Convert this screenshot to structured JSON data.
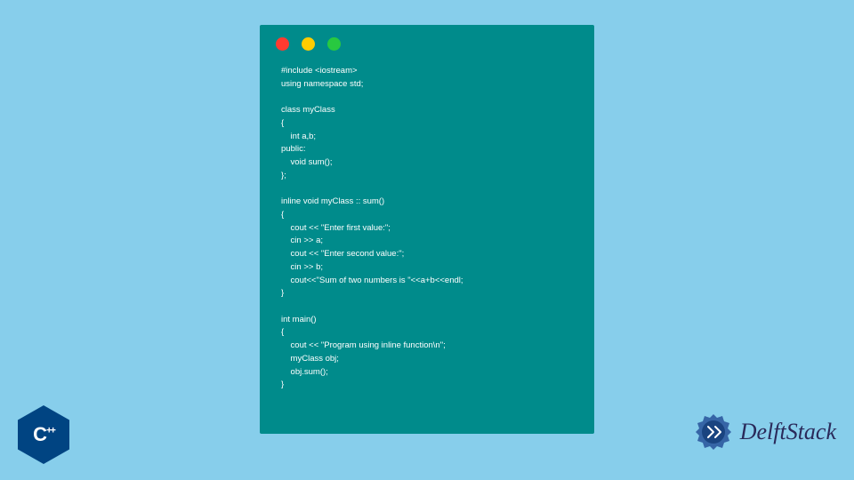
{
  "code_window": {
    "lines": "#include <iostream>\nusing namespace std;\n\nclass myClass\n{\n    int a,b;\npublic:\n    void sum();\n};\n\ninline void myClass :: sum()\n{\n    cout << \"Enter first value:\";\n    cin >> a;\n    cout << \"Enter second value:\";\n    cin >> b;\n    cout<<\"Sum of two numbers is \"<<a+b<<endl;\n}\n\nint main()\n{\n    cout << \"Program using inline function\\n\";\n    myClass obj;\n    obj.sum();\n}"
  },
  "badge": {
    "text_main": "C",
    "text_plus": "++"
  },
  "brand": {
    "name": "DelftStack"
  },
  "colors": {
    "background": "#87ceeb",
    "window": "#008b8b",
    "dot_red": "#ff3b30",
    "dot_yellow": "#ffcc00",
    "dot_green": "#28c940",
    "badge": "#004482",
    "gear": "#2e5a9e"
  }
}
